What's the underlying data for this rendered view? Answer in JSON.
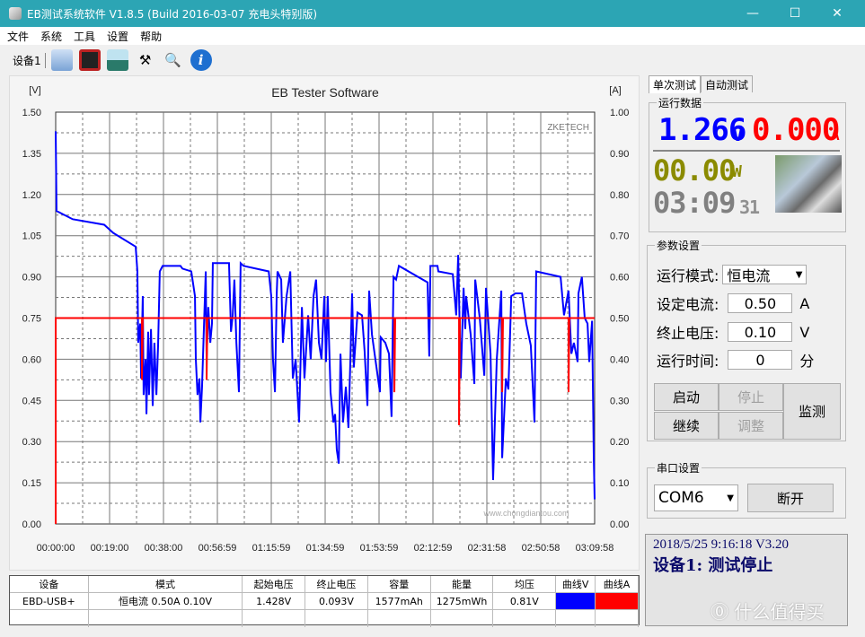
{
  "window": {
    "title": "EB测试系统软件 V1.8.5 (Build 2016-03-07 充电头特别版)",
    "minimize": "—",
    "maximize": "☐",
    "close": "✕"
  },
  "menu": [
    "文件",
    "系统",
    "工具",
    "设置",
    "帮助"
  ],
  "toolbar": {
    "device": "设备1",
    "icons": [
      "folder-icon",
      "save-icon",
      "picture-icon",
      "tools-icon",
      "search-icon",
      "info-icon"
    ]
  },
  "chart_data": {
    "type": "line",
    "title": "EB Tester Software",
    "watermark": "ZKETECH",
    "ylabel_left": "[V]",
    "ylabel_right": "[A]",
    "ylim_left": [
      0,
      1.5
    ],
    "ylim_right": [
      0,
      1.0
    ],
    "xlim": [
      0,
      190
    ],
    "y_ticks_left": [
      "0.00",
      "0.15",
      "0.30",
      "0.45",
      "0.60",
      "0.75",
      "0.90",
      "1.05",
      "1.20",
      "1.35",
      "1.50"
    ],
    "y_ticks_right": [
      "0.00",
      "0.10",
      "0.20",
      "0.30",
      "0.40",
      "0.50",
      "0.60",
      "0.70",
      "0.80",
      "0.90",
      "1.00"
    ],
    "x_ticks": [
      "00:00:00",
      "00:19:00",
      "00:38:00",
      "00:56:59",
      "01:15:59",
      "01:34:59",
      "01:53:59",
      "02:12:59",
      "02:31:58",
      "02:50:58",
      "03:09:58"
    ],
    "grid": true,
    "x_unit": "minutes",
    "series": [
      {
        "axis": "left",
        "color": "#0000ff",
        "points": [
          [
            0,
            1.43
          ],
          [
            0.3,
            1.14
          ],
          [
            6,
            1.11
          ],
          [
            17.1,
            1.09
          ],
          [
            20.3,
            1.06
          ],
          [
            28.2,
            1.01
          ],
          [
            28.8,
            0.92
          ],
          [
            29.1,
            0.66
          ],
          [
            29.8,
            0.73
          ],
          [
            30.1,
            0.53
          ],
          [
            30.7,
            0.83
          ],
          [
            31,
            0.47
          ],
          [
            31.7,
            0.6
          ],
          [
            32,
            0.4
          ],
          [
            32.6,
            0.7
          ],
          [
            32.9,
            0.47
          ],
          [
            33.6,
            0.71
          ],
          [
            34.2,
            0.43
          ],
          [
            34.8,
            0.66
          ],
          [
            35.5,
            0.47
          ],
          [
            36.1,
            0.65
          ],
          [
            36.7,
            0.92
          ],
          [
            37.7,
            0.94
          ],
          [
            44,
            0.94
          ],
          [
            44.7,
            0.93
          ],
          [
            47.8,
            0.92
          ],
          [
            49.1,
            0.83
          ],
          [
            49.4,
            0.6
          ],
          [
            50,
            0.47
          ],
          [
            50.7,
            0.53
          ],
          [
            51,
            0.37
          ],
          [
            51.6,
            0.5
          ],
          [
            52.3,
            0.73
          ],
          [
            52.9,
            0.92
          ],
          [
            53.2,
            0.6
          ],
          [
            53.8,
            0.79
          ],
          [
            54.5,
            0.66
          ],
          [
            55.1,
            0.73
          ],
          [
            55.4,
            0.95
          ],
          [
            56.7,
            0.95
          ],
          [
            61.1,
            0.95
          ],
          [
            61.8,
            0.7
          ],
          [
            62.4,
            0.76
          ],
          [
            63,
            0.89
          ],
          [
            63.7,
            0.66
          ],
          [
            64.6,
            0.48
          ],
          [
            65.2,
            0.95
          ],
          [
            66.2,
            0.94
          ],
          [
            75.1,
            0.92
          ],
          [
            76,
            0.83
          ],
          [
            76.6,
            0.6
          ],
          [
            77.3,
            0.48
          ],
          [
            77.9,
            0.83
          ],
          [
            78.2,
            0.92
          ],
          [
            79.5,
            0.89
          ],
          [
            80.1,
            0.66
          ],
          [
            81.4,
            0.83
          ],
          [
            82.7,
            0.92
          ],
          [
            83.6,
            0.53
          ],
          [
            84.6,
            0.6
          ],
          [
            85.8,
            0.37
          ],
          [
            86.8,
            0.79
          ],
          [
            87.7,
            0.53
          ],
          [
            89,
            0.76
          ],
          [
            89.9,
            0.6
          ],
          [
            90.9,
            0.83
          ],
          [
            91.8,
            0.89
          ],
          [
            92.8,
            0.66
          ],
          [
            93.7,
            0.6
          ],
          [
            94.7,
            0.83
          ],
          [
            95.3,
            0.59
          ],
          [
            95.9,
            0.83
          ],
          [
            96.9,
            0.48
          ],
          [
            97.9,
            0.37
          ],
          [
            98.5,
            0.4
          ],
          [
            99.1,
            0.27
          ],
          [
            99.8,
            0.22
          ],
          [
            100.4,
            0.62
          ],
          [
            101.3,
            0.37
          ],
          [
            102.3,
            0.5
          ],
          [
            103.2,
            0.35
          ],
          [
            103.9,
            0.6
          ],
          [
            104.5,
            0.84
          ],
          [
            105.1,
            0.57
          ],
          [
            106.4,
            0.77
          ],
          [
            108,
            0.76
          ],
          [
            108.9,
            0.63
          ],
          [
            109.9,
            0.43
          ],
          [
            110.5,
            0.85
          ],
          [
            111.5,
            0.69
          ],
          [
            113.1,
            0.57
          ],
          [
            114.3,
            0.48
          ],
          [
            114.6,
            0.68
          ],
          [
            116.2,
            0.66
          ],
          [
            117.5,
            0.62
          ],
          [
            118.4,
            0.39
          ],
          [
            119.1,
            0.9
          ],
          [
            120,
            0.89
          ],
          [
            121,
            0.94
          ],
          [
            131.1,
            0.88
          ],
          [
            131.7,
            0.61
          ],
          [
            132.1,
            0.94
          ],
          [
            134.6,
            0.94
          ],
          [
            134.9,
            0.92
          ],
          [
            140,
            0.91
          ],
          [
            141.2,
            0.76
          ],
          [
            141.9,
            0.98
          ],
          [
            142.8,
            0.53
          ],
          [
            143.8,
            0.86
          ],
          [
            144.4,
            0.71
          ],
          [
            144.7,
            0.83
          ],
          [
            146.3,
            0.69
          ],
          [
            147.6,
            0.51
          ],
          [
            147.9,
            0.89
          ],
          [
            149.5,
            0.75
          ],
          [
            151.1,
            0.54
          ],
          [
            151.7,
            0.86
          ],
          [
            153.3,
            0.62
          ],
          [
            154.2,
            0.16
          ],
          [
            155.5,
            0.6
          ],
          [
            157.1,
            0.85
          ],
          [
            157.4,
            0.24
          ],
          [
            158.7,
            0.53
          ],
          [
            159.6,
            0.49
          ],
          [
            160.6,
            0.83
          ],
          [
            162.1,
            0.84
          ],
          [
            164.4,
            0.84
          ],
          [
            165.9,
            0.73
          ],
          [
            167.5,
            0.65
          ],
          [
            168.8,
            0.37
          ],
          [
            169.4,
            0.92
          ],
          [
            178,
            0.9
          ],
          [
            179.2,
            0.76
          ],
          [
            180.8,
            0.85
          ],
          [
            181.8,
            0.62
          ],
          [
            182.7,
            0.66
          ],
          [
            184,
            0.59
          ],
          [
            184.3,
            0.84
          ],
          [
            185.5,
            0.9
          ],
          [
            186.5,
            0.75
          ],
          [
            187.5,
            0.73
          ],
          [
            188.1,
            0.59
          ],
          [
            189.1,
            0.74
          ],
          [
            189.7,
            0.24
          ],
          [
            190,
            0.09
          ]
        ]
      },
      {
        "axis": "right",
        "color": "#ff0000",
        "points": [
          [
            0,
            0
          ],
          [
            0,
            0.5
          ],
          [
            30.4,
            0.5
          ],
          [
            30.4,
            0.35
          ],
          [
            30.7,
            0.5
          ],
          [
            53.2,
            0.5
          ],
          [
            53.2,
            0.35
          ],
          [
            53.5,
            0.5
          ],
          [
            119.4,
            0.5
          ],
          [
            119.4,
            0.32
          ],
          [
            119.7,
            0.5
          ],
          [
            142.2,
            0.5
          ],
          [
            142.2,
            0.24
          ],
          [
            142.5,
            0.5
          ],
          [
            157.4,
            0.5
          ],
          [
            157.4,
            0.32
          ],
          [
            157.7,
            0.5
          ],
          [
            180.8,
            0.5
          ],
          [
            180.8,
            0.32
          ],
          [
            181.1,
            0.5
          ],
          [
            190,
            0.5
          ]
        ]
      }
    ]
  },
  "table": {
    "headers": [
      "设备",
      "模式",
      "起始电压",
      "终止电压",
      "容量",
      "能量",
      "均压",
      "曲线V",
      "曲线A"
    ],
    "rows": [
      [
        "EBD-USB+",
        "恒电流  0.50A  0.10V",
        "1.428V",
        "0.093V",
        "1577mAh",
        "1275mWh",
        "0.81V",
        "",
        ""
      ]
    ],
    "curve_colors": [
      "#0000ff",
      "#ff0000"
    ]
  },
  "tabs": [
    "单次测试",
    "自动测试"
  ],
  "run_data": {
    "label": "运行数据",
    "voltage": "1.266",
    "voltage_unit": "V",
    "current": "0.000",
    "current_unit": "A",
    "power": "00.00",
    "power_unit": "W",
    "time": "03:09",
    "seconds": "31",
    "voltage_color": "#0000ff",
    "current_color": "#ff0000",
    "power_color": "#8b8b00"
  },
  "params": {
    "label": "参数设置",
    "mode_label": "运行模式:",
    "mode_value": "恒电流",
    "current_label": "设定电流:",
    "current_value": "0.50",
    "current_unit": "A",
    "voltage_label": "终止电压:",
    "voltage_value": "0.10",
    "voltage_unit": "V",
    "time_label": "运行时间:",
    "time_value": "0",
    "time_unit": "分"
  },
  "buttons": {
    "start": "启动",
    "stop": "停止",
    "continue": "继续",
    "adjust": "调整",
    "monitor": "监测"
  },
  "serial": {
    "label": "串口设置",
    "port": "COM6",
    "disconnect": "断开"
  },
  "status": {
    "line1": "2018/5/25 9:16:18  V3.20",
    "line2": "设备1: 测试停止"
  },
  "watermarks": {
    "chongdiantou": "www.chongdiantou.com",
    "smzdm": "值 什么值得买"
  }
}
